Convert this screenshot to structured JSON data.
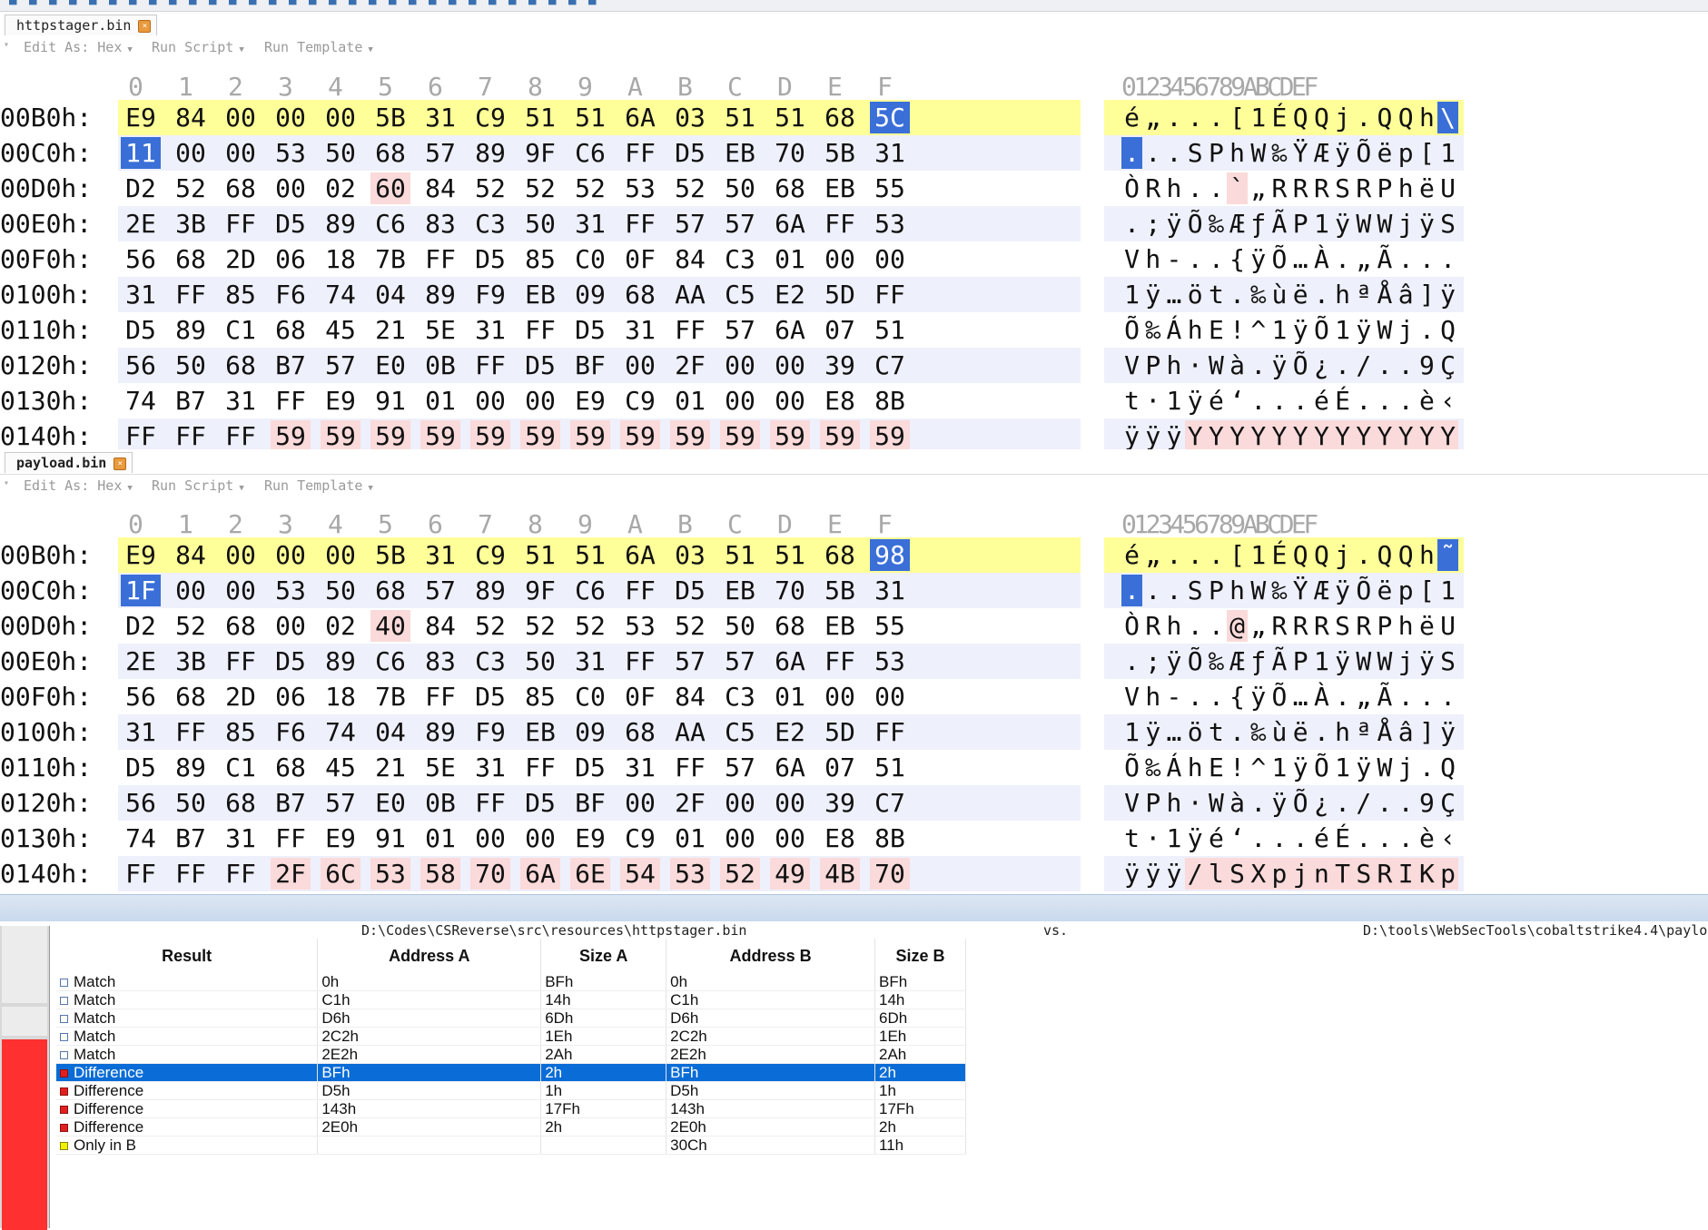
{
  "pane_a": {
    "tab_label": "httpstager.bin",
    "menu": [
      "Edit As: Hex",
      "Run Script",
      "Run Template"
    ],
    "rows": [
      {
        "addr": "00B0h:",
        "hex": [
          "E9",
          "84",
          "00",
          "00",
          "00",
          "5B",
          "31",
          "C9",
          "51",
          "51",
          "6A",
          "03",
          "51",
          "51",
          "68",
          "5C"
        ],
        "ascii": [
          "é",
          "„",
          ".",
          ".",
          ".",
          "[",
          "1",
          "É",
          "Q",
          "Q",
          "j",
          ".",
          "Q",
          "Q",
          "h",
          "\\"
        ],
        "diff": [],
        "sel": [
          15
        ],
        "highlight": true
      },
      {
        "addr": "00C0h:",
        "hex": [
          "11",
          "00",
          "00",
          "53",
          "50",
          "68",
          "57",
          "89",
          "9F",
          "C6",
          "FF",
          "D5",
          "EB",
          "70",
          "5B",
          "31"
        ],
        "ascii": [
          ".",
          ".",
          ".",
          "S",
          "P",
          "h",
          "W",
          "‰",
          "Ÿ",
          "Æ",
          "ÿ",
          "Õ",
          "ë",
          "p",
          "[",
          "1"
        ],
        "diff": [],
        "sel": [
          0
        ]
      },
      {
        "addr": "00D0h:",
        "hex": [
          "D2",
          "52",
          "68",
          "00",
          "02",
          "60",
          "84",
          "52",
          "52",
          "52",
          "53",
          "52",
          "50",
          "68",
          "EB",
          "55"
        ],
        "ascii": [
          "Ò",
          "R",
          "h",
          ".",
          ".",
          "`",
          "„",
          "R",
          "R",
          "R",
          "S",
          "R",
          "P",
          "h",
          "ë",
          "U"
        ],
        "diff": [
          5
        ],
        "sel": []
      },
      {
        "addr": "00E0h:",
        "hex": [
          "2E",
          "3B",
          "FF",
          "D5",
          "89",
          "C6",
          "83",
          "C3",
          "50",
          "31",
          "FF",
          "57",
          "57",
          "6A",
          "FF",
          "53"
        ],
        "ascii": [
          ".",
          ";",
          "ÿ",
          "Õ",
          "‰",
          "Æ",
          "ƒ",
          "Ã",
          "P",
          "1",
          "ÿ",
          "W",
          "W",
          "j",
          "ÿ",
          "S"
        ],
        "diff": [],
        "sel": []
      },
      {
        "addr": "00F0h:",
        "hex": [
          "56",
          "68",
          "2D",
          "06",
          "18",
          "7B",
          "FF",
          "D5",
          "85",
          "C0",
          "0F",
          "84",
          "C3",
          "01",
          "00",
          "00"
        ],
        "ascii": [
          "V",
          "h",
          "-",
          ".",
          ".",
          "{",
          "ÿ",
          "Õ",
          "…",
          "À",
          ".",
          "„",
          "Ã",
          ".",
          ".",
          "."
        ],
        "diff": [],
        "sel": []
      },
      {
        "addr": "0100h:",
        "hex": [
          "31",
          "FF",
          "85",
          "F6",
          "74",
          "04",
          "89",
          "F9",
          "EB",
          "09",
          "68",
          "AA",
          "C5",
          "E2",
          "5D",
          "FF"
        ],
        "ascii": [
          "1",
          "ÿ",
          "…",
          "ö",
          "t",
          ".",
          "‰",
          "ù",
          "ë",
          ".",
          "h",
          "ª",
          "Å",
          "â",
          "]",
          "ÿ"
        ],
        "diff": [],
        "sel": []
      },
      {
        "addr": "0110h:",
        "hex": [
          "D5",
          "89",
          "C1",
          "68",
          "45",
          "21",
          "5E",
          "31",
          "FF",
          "D5",
          "31",
          "FF",
          "57",
          "6A",
          "07",
          "51"
        ],
        "ascii": [
          "Õ",
          "‰",
          "Á",
          "h",
          "E",
          "!",
          "^",
          "1",
          "ÿ",
          "Õ",
          "1",
          "ÿ",
          "W",
          "j",
          ".",
          "Q"
        ],
        "diff": [],
        "sel": []
      },
      {
        "addr": "0120h:",
        "hex": [
          "56",
          "50",
          "68",
          "B7",
          "57",
          "E0",
          "0B",
          "FF",
          "D5",
          "BF",
          "00",
          "2F",
          "00",
          "00",
          "39",
          "C7"
        ],
        "ascii": [
          "V",
          "P",
          "h",
          "·",
          "W",
          "à",
          ".",
          "ÿ",
          "Õ",
          "¿",
          ".",
          "/",
          ".",
          ".",
          "9",
          "Ç"
        ],
        "diff": [],
        "sel": []
      },
      {
        "addr": "0130h:",
        "hex": [
          "74",
          "B7",
          "31",
          "FF",
          "E9",
          "91",
          "01",
          "00",
          "00",
          "E9",
          "C9",
          "01",
          "00",
          "00",
          "E8",
          "8B"
        ],
        "ascii": [
          "t",
          "·",
          "1",
          "ÿ",
          "é",
          "‘",
          ".",
          ".",
          ".",
          "é",
          "É",
          ".",
          ".",
          ".",
          "è",
          "‹"
        ],
        "diff": [],
        "sel": []
      },
      {
        "addr": "0140h:",
        "hex": [
          "FF",
          "FF",
          "FF",
          "59",
          "59",
          "59",
          "59",
          "59",
          "59",
          "59",
          "59",
          "59",
          "59",
          "59",
          "59",
          "59"
        ],
        "ascii": [
          "ÿ",
          "ÿ",
          "ÿ",
          "Y",
          "Y",
          "Y",
          "Y",
          "Y",
          "Y",
          "Y",
          "Y",
          "Y",
          "Y",
          "Y",
          "Y",
          "Y"
        ],
        "diff": [
          3,
          4,
          5,
          6,
          7,
          8,
          9,
          10,
          11,
          12,
          13,
          14,
          15
        ],
        "sel": []
      }
    ]
  },
  "pane_b": {
    "tab_label": "payload.bin",
    "menu": [
      "Edit As: Hex",
      "Run Script",
      "Run Template"
    ],
    "rows": [
      {
        "addr": "00B0h:",
        "hex": [
          "E9",
          "84",
          "00",
          "00",
          "00",
          "5B",
          "31",
          "C9",
          "51",
          "51",
          "6A",
          "03",
          "51",
          "51",
          "68",
          "98"
        ],
        "ascii": [
          "é",
          "„",
          ".",
          ".",
          ".",
          "[",
          "1",
          "É",
          "Q",
          "Q",
          "j",
          ".",
          "Q",
          "Q",
          "h",
          "˜"
        ],
        "diff": [],
        "sel": [
          15
        ],
        "highlight": true
      },
      {
        "addr": "00C0h:",
        "hex": [
          "1F",
          "00",
          "00",
          "53",
          "50",
          "68",
          "57",
          "89",
          "9F",
          "C6",
          "FF",
          "D5",
          "EB",
          "70",
          "5B",
          "31"
        ],
        "ascii": [
          ".",
          ".",
          ".",
          "S",
          "P",
          "h",
          "W",
          "‰",
          "Ÿ",
          "Æ",
          "ÿ",
          "Õ",
          "ë",
          "p",
          "[",
          "1"
        ],
        "diff": [],
        "sel": [
          0
        ]
      },
      {
        "addr": "00D0h:",
        "hex": [
          "D2",
          "52",
          "68",
          "00",
          "02",
          "40",
          "84",
          "52",
          "52",
          "52",
          "53",
          "52",
          "50",
          "68",
          "EB",
          "55"
        ],
        "ascii": [
          "Ò",
          "R",
          "h",
          ".",
          ".",
          "@",
          "„",
          "R",
          "R",
          "R",
          "S",
          "R",
          "P",
          "h",
          "ë",
          "U"
        ],
        "diff": [
          5
        ],
        "sel": []
      },
      {
        "addr": "00E0h:",
        "hex": [
          "2E",
          "3B",
          "FF",
          "D5",
          "89",
          "C6",
          "83",
          "C3",
          "50",
          "31",
          "FF",
          "57",
          "57",
          "6A",
          "FF",
          "53"
        ],
        "ascii": [
          ".",
          ";",
          "ÿ",
          "Õ",
          "‰",
          "Æ",
          "ƒ",
          "Ã",
          "P",
          "1",
          "ÿ",
          "W",
          "W",
          "j",
          "ÿ",
          "S"
        ],
        "diff": [],
        "sel": []
      },
      {
        "addr": "00F0h:",
        "hex": [
          "56",
          "68",
          "2D",
          "06",
          "18",
          "7B",
          "FF",
          "D5",
          "85",
          "C0",
          "0F",
          "84",
          "C3",
          "01",
          "00",
          "00"
        ],
        "ascii": [
          "V",
          "h",
          "-",
          ".",
          ".",
          "{",
          "ÿ",
          "Õ",
          "…",
          "À",
          ".",
          "„",
          "Ã",
          ".",
          ".",
          "."
        ],
        "diff": [],
        "sel": []
      },
      {
        "addr": "0100h:",
        "hex": [
          "31",
          "FF",
          "85",
          "F6",
          "74",
          "04",
          "89",
          "F9",
          "EB",
          "09",
          "68",
          "AA",
          "C5",
          "E2",
          "5D",
          "FF"
        ],
        "ascii": [
          "1",
          "ÿ",
          "…",
          "ö",
          "t",
          ".",
          "‰",
          "ù",
          "ë",
          ".",
          "h",
          "ª",
          "Å",
          "â",
          "]",
          "ÿ"
        ],
        "diff": [],
        "sel": []
      },
      {
        "addr": "0110h:",
        "hex": [
          "D5",
          "89",
          "C1",
          "68",
          "45",
          "21",
          "5E",
          "31",
          "FF",
          "D5",
          "31",
          "FF",
          "57",
          "6A",
          "07",
          "51"
        ],
        "ascii": [
          "Õ",
          "‰",
          "Á",
          "h",
          "E",
          "!",
          "^",
          "1",
          "ÿ",
          "Õ",
          "1",
          "ÿ",
          "W",
          "j",
          ".",
          "Q"
        ],
        "diff": [],
        "sel": []
      },
      {
        "addr": "0120h:",
        "hex": [
          "56",
          "50",
          "68",
          "B7",
          "57",
          "E0",
          "0B",
          "FF",
          "D5",
          "BF",
          "00",
          "2F",
          "00",
          "00",
          "39",
          "C7"
        ],
        "ascii": [
          "V",
          "P",
          "h",
          "·",
          "W",
          "à",
          ".",
          "ÿ",
          "Õ",
          "¿",
          ".",
          "/",
          ".",
          ".",
          "9",
          "Ç"
        ],
        "diff": [],
        "sel": []
      },
      {
        "addr": "0130h:",
        "hex": [
          "74",
          "B7",
          "31",
          "FF",
          "E9",
          "91",
          "01",
          "00",
          "00",
          "E9",
          "C9",
          "01",
          "00",
          "00",
          "E8",
          "8B"
        ],
        "ascii": [
          "t",
          "·",
          "1",
          "ÿ",
          "é",
          "‘",
          ".",
          ".",
          ".",
          "é",
          "É",
          ".",
          ".",
          ".",
          "è",
          "‹"
        ],
        "diff": [],
        "sel": []
      },
      {
        "addr": "0140h:",
        "hex": [
          "FF",
          "FF",
          "FF",
          "2F",
          "6C",
          "53",
          "58",
          "70",
          "6A",
          "6E",
          "54",
          "53",
          "52",
          "49",
          "4B",
          "70"
        ],
        "ascii": [
          "ÿ",
          "ÿ",
          "ÿ",
          "/",
          "l",
          "S",
          "X",
          "p",
          "j",
          "n",
          "T",
          "S",
          "R",
          "I",
          "K",
          "p"
        ],
        "diff": [
          3,
          4,
          5,
          6,
          7,
          8,
          9,
          10,
          11,
          12,
          13,
          14,
          15
        ],
        "sel": []
      }
    ]
  },
  "column_headers": [
    "0",
    "1",
    "2",
    "3",
    "4",
    "5",
    "6",
    "7",
    "8",
    "9",
    "A",
    "B",
    "C",
    "D",
    "E",
    "F"
  ],
  "ascii_header": "0123456789ABCDEF",
  "compare": {
    "file_a": "D:\\Codes\\CSReverse\\src\\resources\\httpstager.bin",
    "vs": "vs.",
    "file_b": "D:\\tools\\WebSecTools\\cobaltstrike4.4\\paylo",
    "headers": {
      "result": "Result",
      "address_a": "Address A",
      "size_a": "Size A",
      "address_b": "Address B",
      "size_b": "Size B"
    },
    "rows": [
      {
        "kind": "match",
        "result": "Match",
        "address_a": "0h",
        "size_a": "BFh",
        "address_b": "0h",
        "size_b": "BFh"
      },
      {
        "kind": "match",
        "result": "Match",
        "address_a": "C1h",
        "size_a": "14h",
        "address_b": "C1h",
        "size_b": "14h"
      },
      {
        "kind": "match",
        "result": "Match",
        "address_a": "D6h",
        "size_a": "6Dh",
        "address_b": "D6h",
        "size_b": "6Dh"
      },
      {
        "kind": "match",
        "result": "Match",
        "address_a": "2C2h",
        "size_a": "1Eh",
        "address_b": "2C2h",
        "size_b": "1Eh"
      },
      {
        "kind": "match",
        "result": "Match",
        "address_a": "2E2h",
        "size_a": "2Ah",
        "address_b": "2E2h",
        "size_b": "2Ah"
      },
      {
        "kind": "diff",
        "result": "Difference",
        "address_a": "BFh",
        "size_a": "2h",
        "address_b": "BFh",
        "size_b": "2h",
        "selected": true
      },
      {
        "kind": "diff",
        "result": "Difference",
        "address_a": "D5h",
        "size_a": "1h",
        "address_b": "D5h",
        "size_b": "1h"
      },
      {
        "kind": "diff",
        "result": "Difference",
        "address_a": "143h",
        "size_a": "17Fh",
        "address_b": "143h",
        "size_b": "17Fh"
      },
      {
        "kind": "diff",
        "result": "Difference",
        "address_a": "2E0h",
        "size_a": "2h",
        "address_b": "2E0h",
        "size_b": "2h"
      },
      {
        "kind": "onlyb",
        "result": "Only in B",
        "address_a": "",
        "size_a": "",
        "address_b": "30Ch",
        "size_b": "11h"
      }
    ]
  },
  "colors": {
    "highlight_row": "#ffff99",
    "alt_row": "#eef0fb",
    "diff_cell": "#fadada",
    "selection": "#3a6fd8",
    "table_selection": "#0a6cd6",
    "strip_red": "#ff3030"
  }
}
